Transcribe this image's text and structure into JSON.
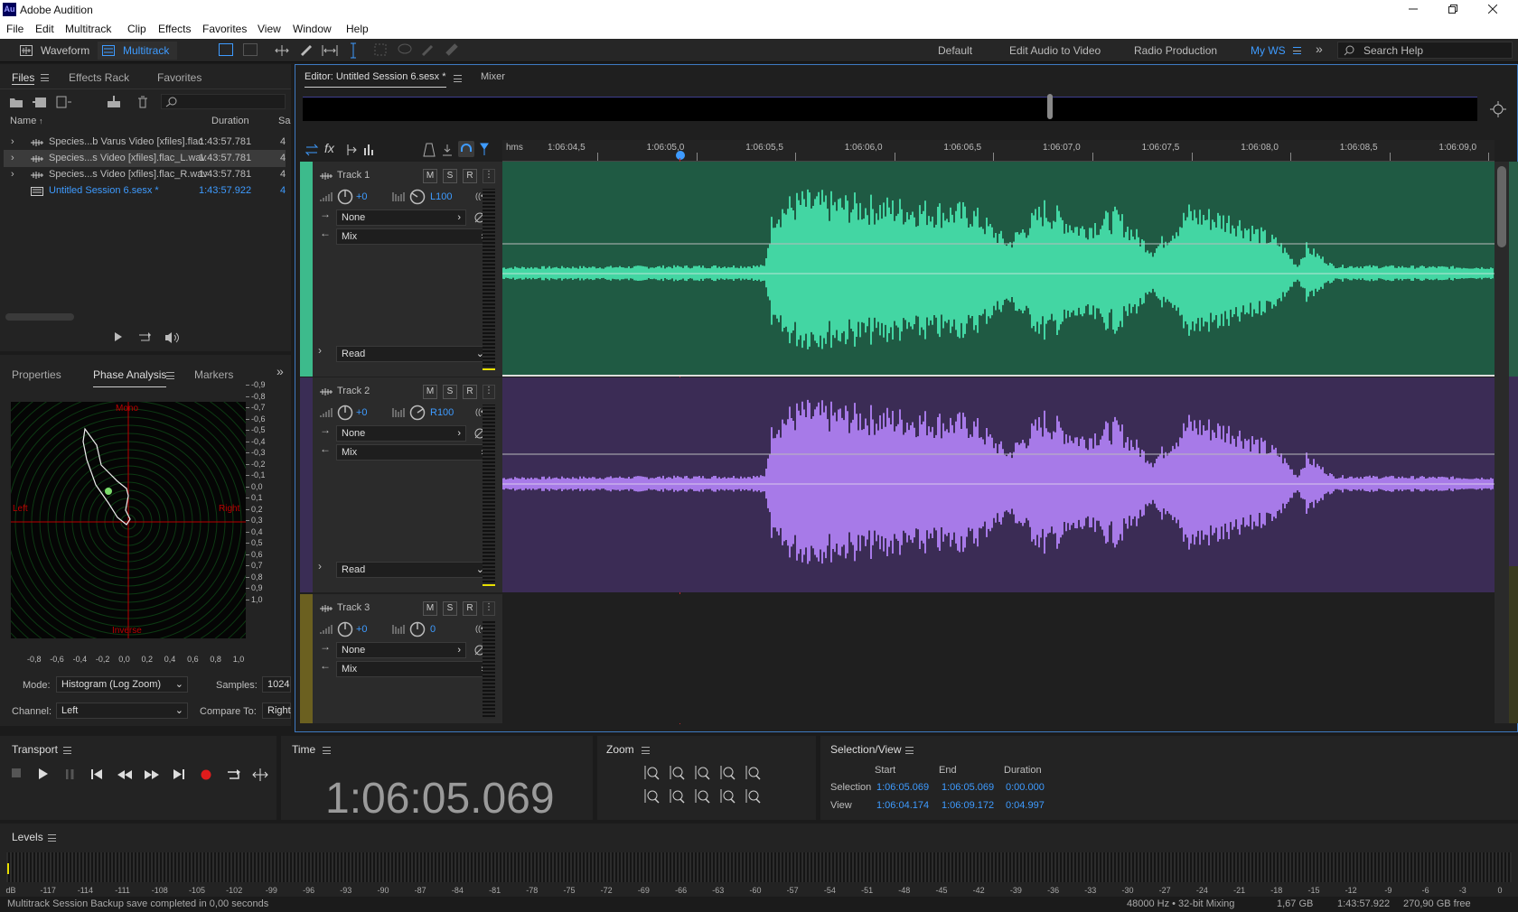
{
  "app": {
    "title": "Adobe Audition",
    "logo": "Au"
  },
  "menu": [
    "File",
    "Edit",
    "Multitrack",
    "Clip",
    "Effects",
    "Favorites",
    "View",
    "Window",
    "Help"
  ],
  "toolbar": {
    "waveform": "Waveform",
    "multitrack": "Multitrack",
    "workspaces": [
      "Default",
      "Edit Audio to Video",
      "Radio Production",
      "My WS"
    ],
    "search_placeholder": "Search Help"
  },
  "files_panel": {
    "tabs": [
      "Files",
      "Effects Rack",
      "Favorites"
    ],
    "columns": {
      "name": "Name",
      "duration": "Duration",
      "sr": "Sa"
    },
    "items": [
      {
        "name": "Species...b Varus Video [xfiles].flac",
        "duration": "1:43:57.781",
        "sr": "4",
        "selected": false
      },
      {
        "name": "Species...s Video [xfiles].flac_L.wav",
        "duration": "1:43:57.781",
        "sr": "4",
        "selected": true
      },
      {
        "name": "Species...s Video [xfiles].flac_R.wav",
        "duration": "1:43:57.781",
        "sr": "4",
        "selected": false
      },
      {
        "name": "Untitled Session 6.sesx *",
        "duration": "1:43:57.922",
        "sr": "4",
        "session": true
      }
    ]
  },
  "phase_panel": {
    "tabs": [
      "Properties",
      "Phase Analysis",
      "Markers"
    ],
    "labels": {
      "mono": "Mono",
      "inverse": "Inverse",
      "left": "Left",
      "right": "Right"
    },
    "y_ticks": [
      "-0,9",
      "-0,8",
      "-0,7",
      "-0,6",
      "-0,5",
      "-0,4",
      "-0,3",
      "-0,2",
      "-0,1",
      "0,0",
      "0,1",
      "0,2",
      "0,3",
      "0,4",
      "0,5",
      "0,6",
      "0,7",
      "0,8",
      "0,9",
      "1,0"
    ],
    "x_ticks": [
      "-0,8",
      "-0,6",
      "-0,4",
      "-0,2",
      "0,0",
      "0,2",
      "0,4",
      "0,6",
      "0,8",
      "1,0"
    ],
    "mode_label": "Mode:",
    "mode_value": "Histogram (Log Zoom)",
    "samples_label": "Samples:",
    "samples_value": "1024",
    "channel_label": "Channel:",
    "channel_value": "Left",
    "compare_label": "Compare To:",
    "compare_value": "Right"
  },
  "editor": {
    "tab": "Editor: Untitled Session 6.sesx *",
    "mixer": "Mixer",
    "ruler_unit": "hms",
    "ruler": [
      "1:06:04,5",
      "1:06:05,0",
      "1:06:05,5",
      "1:06:06,0",
      "1:06:06,5",
      "1:06:07,0",
      "1:06:07,5",
      "1:06:08,0",
      "1:06:08,5",
      "1:06:09,0"
    ],
    "tracks": [
      {
        "name": "Track 1",
        "volume": "+0",
        "pan": "L100",
        "input": "None",
        "output": "Mix",
        "auto": "Read",
        "color": "#43d6a3",
        "bg": "#1f5a43",
        "strip": "#3dbb8c"
      },
      {
        "name": "Track 2",
        "volume": "+0",
        "pan": "R100",
        "input": "None",
        "output": "Mix",
        "auto": "Read",
        "color": "#a77ae8",
        "bg": "#3b2c55",
        "strip": "#3a2d55"
      },
      {
        "name": "Track 3",
        "volume": "+0",
        "pan": "0",
        "input": "None",
        "output": "Mix",
        "color": "#6b6020",
        "bg": "#1f1f1f",
        "strip": "#6b6020"
      }
    ],
    "track_buttons": [
      "M",
      "S",
      "R"
    ]
  },
  "transport": {
    "title": "Transport"
  },
  "time": {
    "title": "Time",
    "value": "1:06:05.069"
  },
  "zoom": {
    "title": "Zoom"
  },
  "selview": {
    "title": "Selection/View",
    "cols": [
      "Start",
      "End",
      "Duration"
    ],
    "selection": {
      "label": "Selection",
      "start": "1:06:05.069",
      "end": "1:06:05.069",
      "duration": "0:00.000"
    },
    "view": {
      "label": "View",
      "start": "1:06:04.174",
      "end": "1:06:09.172",
      "duration": "0:04.997"
    }
  },
  "levels": {
    "title": "Levels",
    "ticks": [
      "dB",
      "-117",
      "-114",
      "-111",
      "-108",
      "-105",
      "-102",
      "-99",
      "-96",
      "-93",
      "-90",
      "-87",
      "-84",
      "-81",
      "-78",
      "-75",
      "-72",
      "-69",
      "-66",
      "-63",
      "-60",
      "-57",
      "-54",
      "-51",
      "-48",
      "-45",
      "-42",
      "-39",
      "-36",
      "-33",
      "-30",
      "-27",
      "-24",
      "-21",
      "-18",
      "-15",
      "-12",
      "-9",
      "-6",
      "-3",
      "0"
    ]
  },
  "status": {
    "message": "Multitrack Session Backup save completed in 0,00 seconds",
    "format": "48000 Hz • 32-bit Mixing",
    "size": "1,67 GB",
    "duration": "1:43:57.922",
    "free": "270,90 GB free"
  }
}
